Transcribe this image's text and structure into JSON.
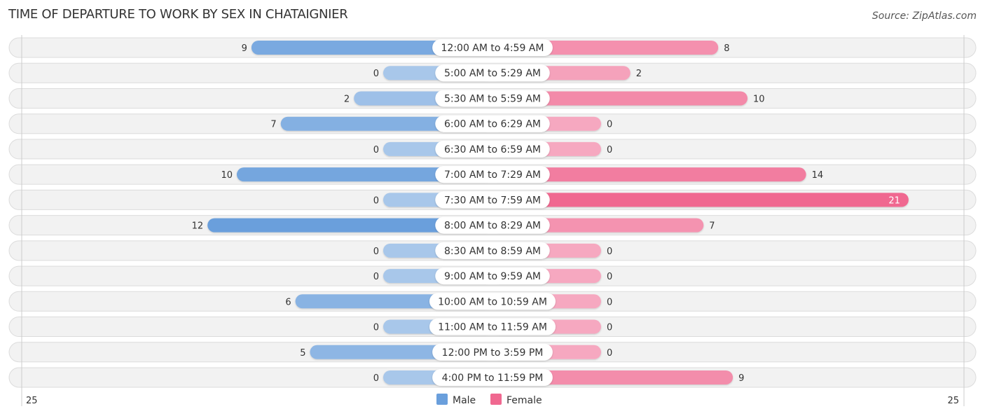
{
  "title": "TIME OF DEPARTURE TO WORK BY SEX IN CHATAIGNIER",
  "source": "Source: ZipAtlas.com",
  "colors": {
    "male": "#6a9fdc",
    "male_light": "#a8c7ea",
    "female": "#f06890",
    "female_light": "#f6a8c0",
    "track": "#f2f2f2"
  },
  "chart_data": {
    "type": "bar",
    "orientation": "horizontal-diverging",
    "title": "TIME OF DEPARTURE TO WORK BY SEX IN CHATAIGNIER",
    "categories": [
      "12:00 AM to 4:59 AM",
      "5:00 AM to 5:29 AM",
      "5:30 AM to 5:59 AM",
      "6:00 AM to 6:29 AM",
      "6:30 AM to 6:59 AM",
      "7:00 AM to 7:29 AM",
      "7:30 AM to 7:59 AM",
      "8:00 AM to 8:29 AM",
      "8:30 AM to 8:59 AM",
      "9:00 AM to 9:59 AM",
      "10:00 AM to 10:59 AM",
      "11:00 AM to 11:59 AM",
      "12:00 PM to 3:59 PM",
      "4:00 PM to 11:59 PM"
    ],
    "series": [
      {
        "name": "Male",
        "values": [
          9,
          0,
          2,
          7,
          0,
          10,
          0,
          12,
          0,
          0,
          6,
          0,
          5,
          0
        ]
      },
      {
        "name": "Female",
        "values": [
          8,
          2,
          10,
          0,
          0,
          14,
          21,
          7,
          0,
          0,
          0,
          0,
          0,
          9
        ]
      }
    ],
    "axis_max": 25,
    "axis_labels": {
      "left": "25",
      "right": "25"
    },
    "legend": {
      "position": "bottom-center",
      "entries": [
        "Male",
        "Female"
      ]
    }
  }
}
